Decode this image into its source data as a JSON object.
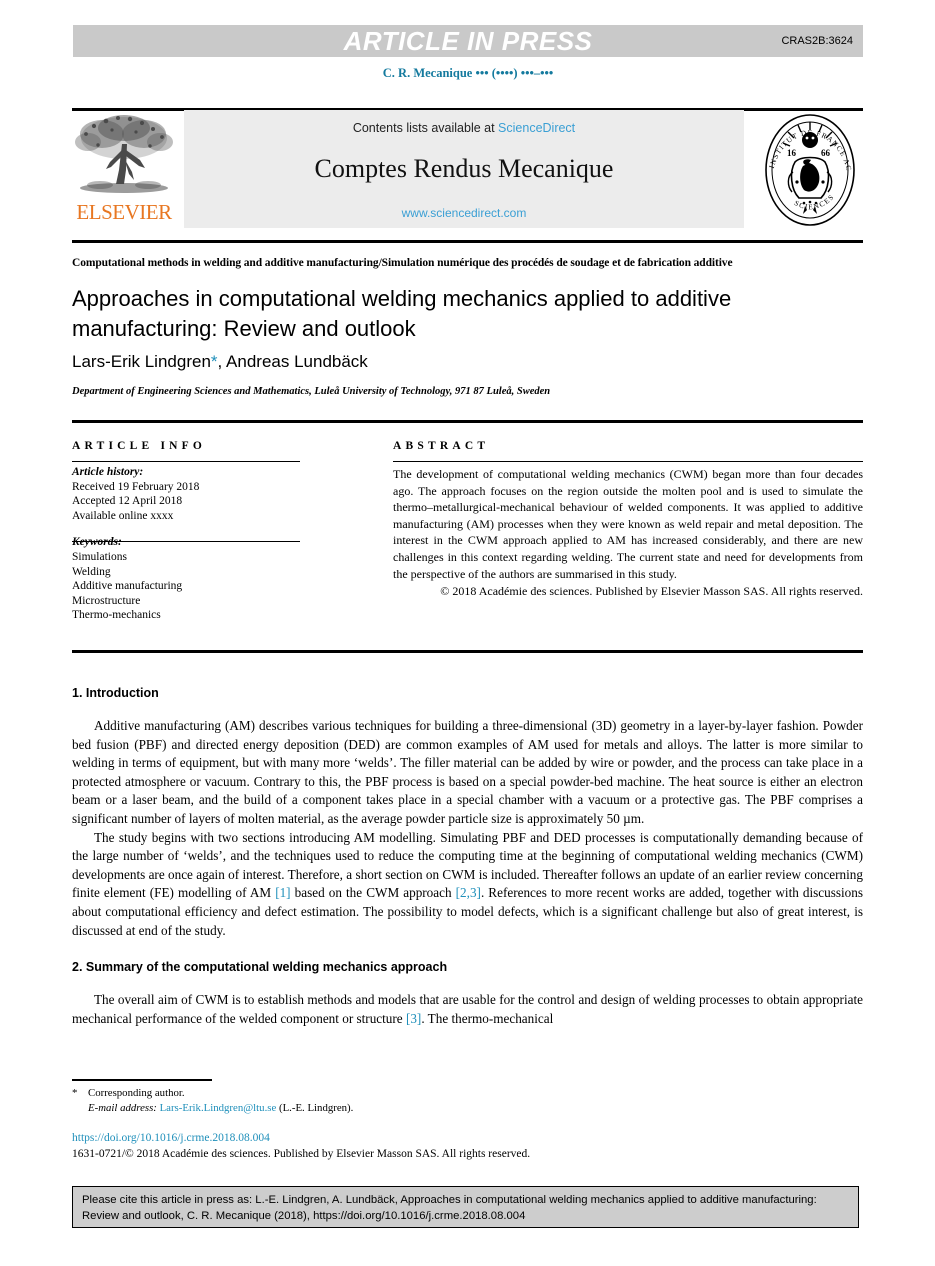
{
  "banner": {
    "label": "ARTICLE IN PRESS",
    "code": "CRAS2B:3624",
    "bg_color": "#c9c9c9"
  },
  "running_head": "C. R. Mecanique ••• (••••) •••–•••",
  "masthead": {
    "contents_prefix": "Contents lists available at ",
    "sciencedirect": "ScienceDirect",
    "journal_title": "Comptes Rendus Mecanique",
    "website": "www.sciencedirect.com",
    "publisher_wordmark": "ELSEVIER",
    "publisher_color": "#e87722",
    "seal_name": "academie-des-sciences-seal",
    "link_color": "#3a9fd4"
  },
  "kicker": "Computational methods in welding and additive manufacturing/Simulation numérique des procédés de soudage et de fabrication additive",
  "title": "Approaches in computational welding mechanics applied to additive manufacturing: Review and outlook",
  "authors": {
    "first": "Lars-Erik Lindgren",
    "star": "*",
    "rest": ", Andreas Lundbäck"
  },
  "affiliation": "Department of Engineering Sciences and Mathematics, Luleå University of Technology, 971 87 Luleå, Sweden",
  "info": {
    "heading": "ARTICLE INFO",
    "history_label": "Article history:",
    "history": [
      "Received 19 February 2018",
      "Accepted 12 April 2018",
      "Available online xxxx"
    ],
    "keywords_label": "Keywords:",
    "keywords": [
      "Simulations",
      "Welding",
      "Additive manufacturing",
      "Microstructure",
      "Thermo-mechanics"
    ]
  },
  "abstract": {
    "heading": "ABSTRACT",
    "text": "The development of computational welding mechanics (CWM) began more than four decades ago. The approach focuses on the region outside the molten pool and is used to simulate the thermo–metallurgical-mechanical behaviour of welded components. It was applied to additive manufacturing (AM) processes when they were known as weld repair and metal deposition. The interest in the CWM approach applied to AM has increased considerably, and there are new challenges in this context regarding welding. The current state and need for developments from the perspective of the authors are summarised in this study.",
    "copyright": "© 2018 Académie des sciences. Published by Elsevier Masson SAS. All rights reserved."
  },
  "sections": {
    "intro_heading": "1. Introduction",
    "intro_p1": "Additive manufacturing (AM) describes various techniques for building a three-dimensional (3D) geometry in a layer-by-layer fashion. Powder bed fusion (PBF) and directed energy deposition (DED) are common examples of AM used for metals and alloys. The latter is more similar to welding in terms of equipment, but with many more ‘welds’. The filler material can be added by wire or powder, and the process can take place in a protected atmosphere or vacuum. Contrary to this, the PBF process is based on a special powder-bed machine. The heat source is either an electron beam or a laser beam, and the build of a component takes place in a special chamber with a vacuum or a protective gas. The PBF comprises a significant number of layers of molten material, as the average powder particle size is approximately 50 µm.",
    "intro_p2_a": "The study begins with two sections introducing AM modelling. Simulating PBF and DED processes is computationally demanding because of the large number of ‘welds’, and the techniques used to reduce the computing time at the beginning of computational welding mechanics (CWM) developments are once again of interest. Therefore, a short section on CWM is included. Thereafter follows an update of an earlier review concerning finite element (FE) modelling of AM ",
    "intro_p2_cite1": "[1]",
    "intro_p2_b": " based on the CWM approach ",
    "intro_p2_cite2": "[2,3]",
    "intro_p2_c": ". References to more recent works are added, together with discussions about computational efficiency and defect estimation. The possibility to model defects, which is a significant challenge but also of great interest, is discussed at end of the study.",
    "summary_heading": "2. Summary of the computational welding mechanics approach",
    "summary_p1_a": "The overall aim of CWM is to establish methods and models that are usable for the control and design of welding processes to obtain appropriate mechanical performance of the welded component or structure ",
    "summary_p1_cite": "[3]",
    "summary_p1_b": ". The thermo-mechanical"
  },
  "footer": {
    "corresponding_star": "*",
    "corresponding_author": "Corresponding author.",
    "email_label": "E-mail address:",
    "email": "Lars-Erik.Lindgren@ltu.se",
    "email_owner": "(L.-E. Lindgren).",
    "doi_url": "https://doi.org/10.1016/j.crme.2018.08.004",
    "issn_line": "1631-0721/© 2018 Académie des sciences. Published by Elsevier Masson SAS. All rights reserved.",
    "link_color": "#1f8fba"
  },
  "cite_box": {
    "line1": "Please cite this article in press as: L.-E. Lindgren, A. Lundbäck, Approaches in computational welding mechanics applied to additive manufacturing:",
    "line2": "Review and outlook, C. R. Mecanique (2018), https://doi.org/10.1016/j.crme.2018.08.004",
    "bg_color": "#cdcdcd"
  }
}
